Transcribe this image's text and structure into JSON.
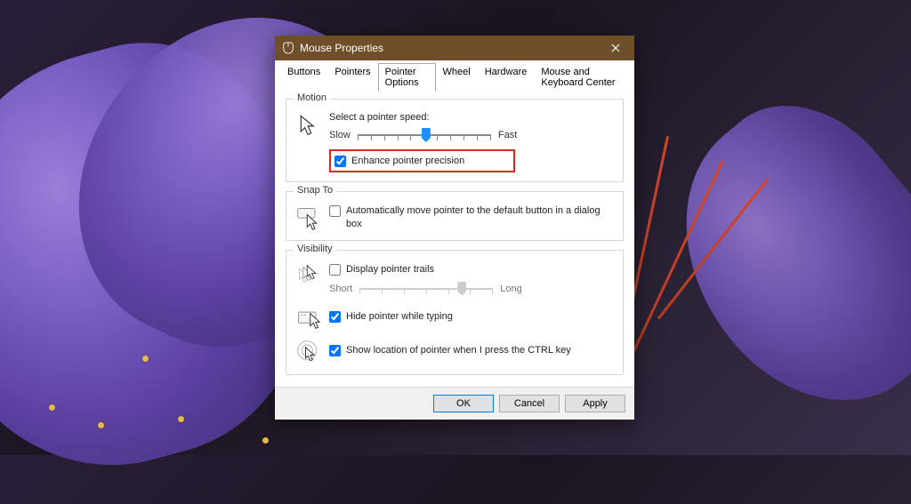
{
  "window": {
    "title": "Mouse Properties"
  },
  "tabs": [
    {
      "label": "Buttons",
      "active": false
    },
    {
      "label": "Pointers",
      "active": false
    },
    {
      "label": "Pointer Options",
      "active": true
    },
    {
      "label": "Wheel",
      "active": false
    },
    {
      "label": "Hardware",
      "active": false
    },
    {
      "label": "Mouse and Keyboard Center",
      "active": false
    }
  ],
  "groups": {
    "motion": {
      "label": "Motion",
      "speed_label": "Select a pointer speed:",
      "slow": "Slow",
      "fast": "Fast",
      "slider_value": 6,
      "slider_min": 1,
      "slider_max": 11,
      "enhance": {
        "label": "Enhance pointer precision",
        "checked": true,
        "highlighted": true
      }
    },
    "snap": {
      "label": "Snap To",
      "auto": {
        "label": "Automatically move pointer to the default button in a dialog box",
        "checked": false
      }
    },
    "visibility": {
      "label": "Visibility",
      "trails": {
        "label": "Display pointer trails",
        "checked": false
      },
      "short": "Short",
      "long": "Long",
      "hide": {
        "label": "Hide pointer while typing",
        "checked": true
      },
      "ctrl": {
        "label": "Show location of pointer when I press the CTRL key",
        "checked": true
      }
    }
  },
  "buttons": {
    "ok": "OK",
    "cancel": "Cancel",
    "apply": "Apply"
  }
}
